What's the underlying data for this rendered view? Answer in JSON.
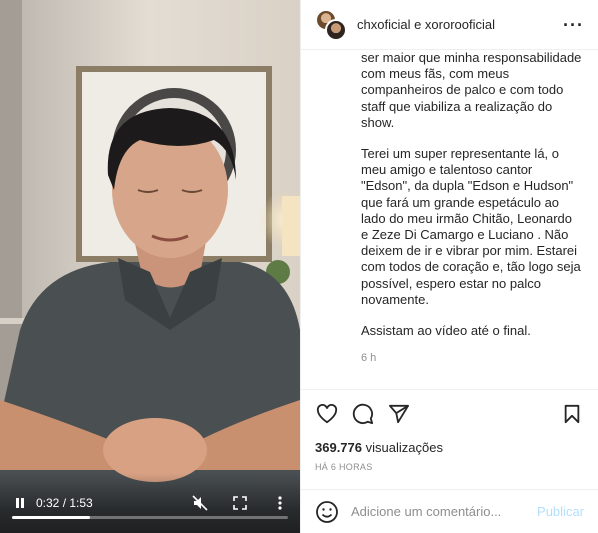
{
  "post": {
    "username": "chxoficial e xororooficial",
    "more_icon": "more-horizontal-icon"
  },
  "caption": {
    "paragraphs": [
      "ser maior que minha responsabilidade com meus fãs, com meus companheiros de palco e com todo staff que viabiliza a realização do show.",
      "Terei um super representante lá, o meu amigo e talentoso cantor \"Edson\", da dupla \"Edson e Hudson\" que fará um grande espetáculo ao lado do meu irmão Chitão, Leonardo e Zeze Di Camargo e Luciano . Não deixem de ir e vibrar por mim. Estarei com todos de coração e, tão logo seja possível, espero estar no palco novamente.",
      "Assistam ao vídeo até o final."
    ],
    "ago": "6 h"
  },
  "stats": {
    "views_count": "369.776",
    "views_label": "visualizações",
    "posted": "HÁ 6 HORAS"
  },
  "comment": {
    "placeholder": "Adicione um comentário...",
    "publish_label": "Publicar"
  },
  "video": {
    "time": "0:32 / 1:53",
    "progress": 0.283
  },
  "colors": {
    "link_disabled": "#b2dffc",
    "muted_text": "#8e8e8e",
    "divider": "#efefef"
  }
}
